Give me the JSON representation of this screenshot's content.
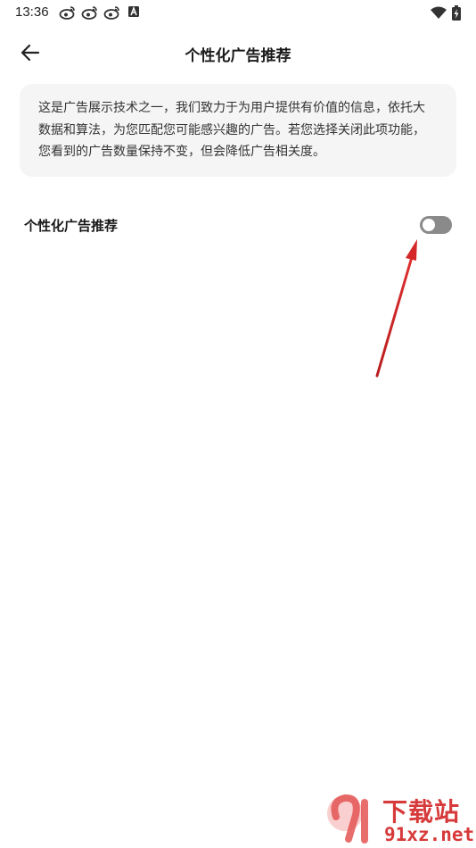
{
  "status_bar": {
    "time": "13:36",
    "notification_icons": [
      "weibo-icon",
      "weibo-icon",
      "weibo-icon",
      "a-badge-icon"
    ],
    "right_icons": [
      "wifi-icon",
      "battery-charging-icon"
    ]
  },
  "header": {
    "title": "个性化广告推荐",
    "back_icon": "back-arrow-icon"
  },
  "info_card": {
    "text": "这是广告展示技术之一，我们致力于为用户提供有价值的信息，依托大数据和算法，为您匹配您可能感兴趣的广告。若您选择关闭此项功能，您看到的广告数量保持不变，但会降低广告相关度。"
  },
  "setting": {
    "label": "个性化广告推荐",
    "enabled": false
  },
  "watermark": {
    "title": "下载站",
    "site": "91xz.net"
  },
  "colors": {
    "toggle_off": "#8a8a8a",
    "card_bg": "#f5f5f5",
    "annotation_arrow": "#d42828",
    "watermark": "#d73a3a"
  }
}
